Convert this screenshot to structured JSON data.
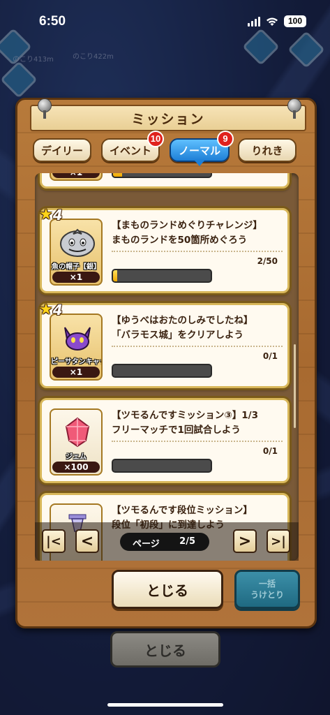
{
  "status_bar": {
    "time": "6:50",
    "battery": "100"
  },
  "map": {
    "labels": [
      "のこり413m",
      "のこり422m"
    ]
  },
  "dialog": {
    "title": "ミッション",
    "tabs": [
      {
        "label": "デイリー"
      },
      {
        "label": "イベント",
        "badge": "10"
      },
      {
        "label": "ノーマル",
        "badge": "9",
        "active": true
      },
      {
        "label": "りれき"
      }
    ],
    "missions": [
      {
        "reward_name": "",
        "reward_qty": "×1",
        "progress_fraction": 0.09
      },
      {
        "stars": "4",
        "reward_name": "魚の帽子【銀】",
        "reward_qty": "×1",
        "title": "【まものランドめぐりチャレンジ】",
        "desc": "まものランドを50箇所めぐろう",
        "progress_text": "2/50",
        "progress_fraction": 0.04
      },
      {
        "stars": "4",
        "reward_name": "ピーサタンキャップ",
        "reward_qty": "×1",
        "title": "【ゆうべはおたのしみでしたね】",
        "desc": "「バラモス城」をクリアしよう",
        "progress_text": "0/1",
        "progress_fraction": 0
      },
      {
        "reward_name": "ジェム",
        "reward_qty": "×100",
        "title": "【ツモるんですミッション③】1/3",
        "desc": "フリーマッチで1回試合しよう",
        "progress_text": "0/1",
        "progress_fraction": 0
      },
      {
        "title": "【ツモるんです段位ミッション】",
        "desc": "段位「初段」に到達しよう"
      }
    ],
    "pager": {
      "label": "ページ",
      "page": "2/5",
      "first": "|<",
      "prev": "<",
      "next": ">",
      "last": ">|"
    },
    "close_label": "とじる",
    "claim_label_1": "一括",
    "claim_label_2": "うけとり"
  },
  "outer_close_label": "とじる",
  "colors": {
    "tab_active": "#1e7fd6",
    "badge": "#e0221d",
    "progress_fill": "#f0a800",
    "card_border": "#d8b75a"
  }
}
